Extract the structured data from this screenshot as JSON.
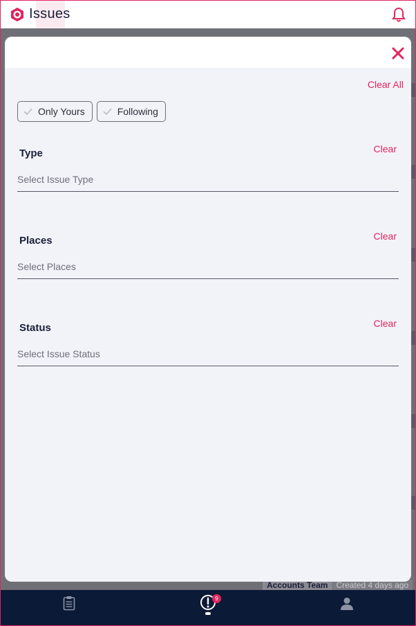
{
  "app": {
    "title": "Issues"
  },
  "filters": {
    "clear_all": "Clear All",
    "chips": [
      {
        "label": "Only Yours",
        "checked": false
      },
      {
        "label": "Following",
        "checked": false
      }
    ],
    "sections": [
      {
        "label": "Type",
        "clear": "Clear",
        "placeholder": "Select Issue Type"
      },
      {
        "label": "Places",
        "clear": "Clear",
        "placeholder": "Select Places"
      },
      {
        "label": "Status",
        "clear": "Clear",
        "placeholder": "Select Issue Status"
      }
    ]
  },
  "background": {
    "team": "Accounts Team",
    "created": "Created 4 days ago"
  },
  "bottom_nav": {
    "items": [
      {
        "icon": "clipboard-icon"
      },
      {
        "icon": "alert-icon",
        "badge": "9"
      },
      {
        "icon": "person-icon"
      }
    ]
  },
  "colors": {
    "accent": "#e0245e",
    "nav_bg": "#0b1a36",
    "sheet_bg": "#f2f3f8"
  }
}
